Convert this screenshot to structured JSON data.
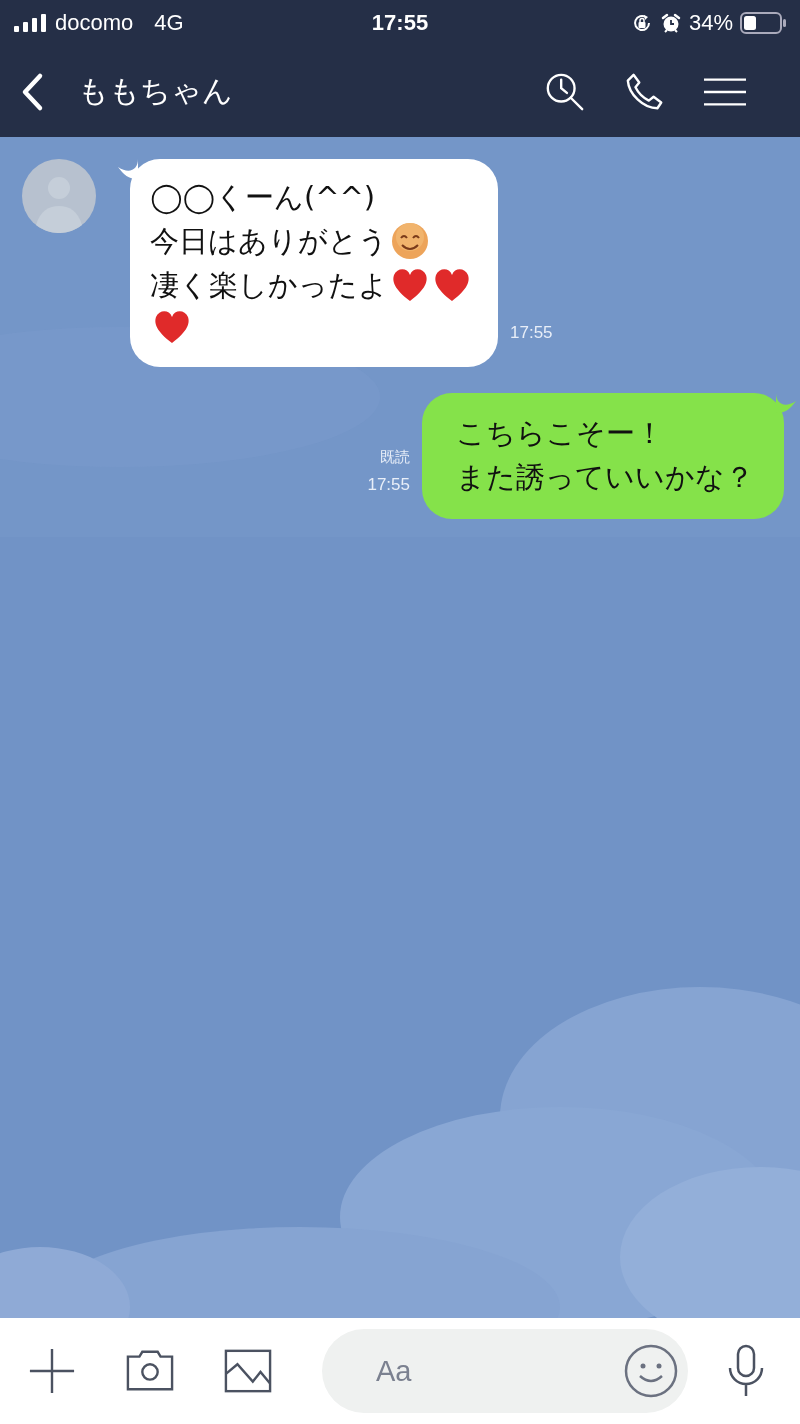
{
  "status_bar": {
    "carrier": "docomo",
    "network": "4G",
    "time": "17:55",
    "battery": "34%"
  },
  "header": {
    "title": "ももちゃん"
  },
  "messages": [
    {
      "kind": "received",
      "time": "17:55",
      "lines": [
        [
          {
            "kind": "text",
            "text": "◯◯くーん(^^)"
          }
        ],
        [
          {
            "kind": "text",
            "text": "今日はありがとう"
          },
          {
            "kind": "smile"
          }
        ],
        [
          {
            "kind": "text",
            "text": "凄く楽しかったよ"
          },
          {
            "kind": "heart"
          },
          {
            "kind": "heart"
          }
        ],
        [
          {
            "kind": "heart"
          }
        ]
      ]
    },
    {
      "kind": "sent",
      "read": "既読",
      "time": "17:55",
      "lines": [
        [
          {
            "kind": "text",
            "text": "こちらこそー！"
          }
        ],
        [
          {
            "kind": "text",
            "text": "また誘っていいかな？"
          }
        ]
      ]
    }
  ],
  "input": {
    "placeholder": "Aa"
  }
}
